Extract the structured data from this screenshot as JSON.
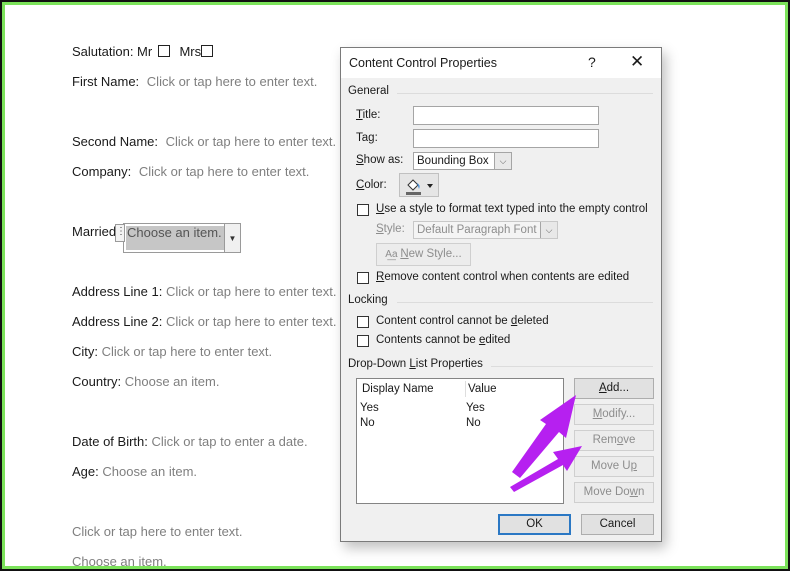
{
  "document": {
    "salutation": {
      "label": "Salutation: Mr",
      "option2": "Mrs"
    },
    "first_name": {
      "label": "First Name:",
      "placeholder": "Click or tap here to enter text."
    },
    "second_name": {
      "label": "Second Name:",
      "placeholder": "Click or tap here to enter text."
    },
    "company": {
      "label": "Company:",
      "placeholder": "Click or tap here to enter text."
    },
    "married": {
      "label": "Married:",
      "placeholder": "Choose an item."
    },
    "address1": {
      "label": "Address Line 1:",
      "placeholder": "Click or tap here to enter text."
    },
    "address2": {
      "label": "Address Line 2:",
      "placeholder": "Click or tap here to enter text."
    },
    "city": {
      "label": "City:",
      "placeholder": "Click or tap here to enter text."
    },
    "country": {
      "label": "Country:",
      "placeholder": "Choose an item."
    },
    "dob": {
      "label": "Date of Birth:",
      "placeholder": "Click or tap to enter a date."
    },
    "age": {
      "label": "Age:",
      "placeholder": "Choose an item."
    },
    "extra_text": "Click or tap here to enter text.",
    "extra_choice": "Choose an item."
  },
  "dialog": {
    "title": "Content Control Properties",
    "help": "?",
    "close": "✕",
    "general": {
      "heading": "General",
      "title_label_u": "T",
      "title_label_rest": "itle:",
      "title_value": "",
      "tag_label_a": "Ta",
      "tag_label_u": "g",
      "tag_label_rest": ":",
      "show_as_u": "S",
      "show_as_rest": "how as:",
      "show_as_value": "Bounding Box",
      "color_u": "C",
      "color_rest": "olor:",
      "use_style_u": "U",
      "use_style_rest": "se a style to format text typed into the empty control",
      "use_style_checked": false,
      "style_u": "S",
      "style_rest": "tyle:",
      "style_value": "Default Paragraph Font",
      "new_style_u": "N",
      "new_style_rest": "ew Style...",
      "remove_u": "R",
      "remove_rest": "emove content control when contents are edited",
      "remove_checked": false
    },
    "locking": {
      "heading": "Locking",
      "cannot_delete_a": "Content control cannot be ",
      "cannot_delete_u": "d",
      "cannot_delete_rest": "eleted",
      "cannot_delete_checked": false,
      "cannot_edit_a": "Contents cannot be ",
      "cannot_edit_u": "e",
      "cannot_edit_rest": "dited",
      "cannot_edit_checked": false
    },
    "dropdown": {
      "heading_a": "Drop-Down ",
      "heading_u": "L",
      "heading_rest": "ist Properties",
      "columns": [
        "Display Name",
        "Value"
      ],
      "rows": [
        {
          "display": "Yes",
          "value": "Yes"
        },
        {
          "display": "No",
          "value": "No"
        }
      ],
      "buttons": {
        "add_u": "A",
        "add_rest": "dd...",
        "modify_u": "M",
        "modify_rest": "odify...",
        "remove_a": "Rem",
        "remove_u": "o",
        "remove_rest": "ve",
        "move_up_a": "Move U",
        "move_up_u": "p",
        "move_down_a": "Move Do",
        "move_down_u": "w",
        "move_down_rest": "n"
      }
    },
    "ok": "OK",
    "cancel": "Cancel"
  },
  "annotation": {
    "arrow_color": "#b620f0"
  }
}
